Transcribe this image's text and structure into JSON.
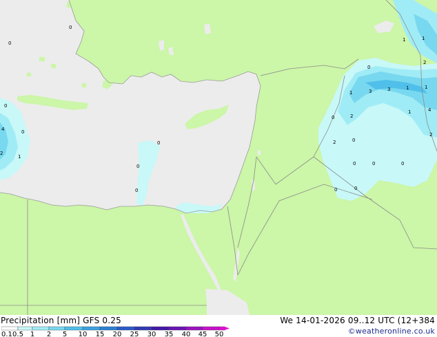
{
  "footer": {
    "title": "Precipitation [mm]  GFS 0.25",
    "datetime": "We 14-01-2026 09..12 UTC (12+384",
    "credit": "©weatheronline.co.uk"
  },
  "legend": {
    "ticks": [
      "0.1",
      "0.5",
      "1",
      "2",
      "5",
      "10",
      "15",
      "20",
      "25",
      "30",
      "35",
      "40",
      "45",
      "50"
    ],
    "colors": [
      "#ffffff",
      "#c8f8f8",
      "#a0ecf6",
      "#78d8ef",
      "#50c0ea",
      "#3aa2e0",
      "#2c80d4",
      "#2a5cc8",
      "#3038b4",
      "#4218a8",
      "#6a14b4",
      "#9a12c0",
      "#c810cc",
      "#e80cd8"
    ]
  },
  "colors": {
    "land": "#ccf6a8",
    "sea": "#ececec",
    "border": "#8a8a8a"
  },
  "map_values": [
    "1",
    "1",
    "0",
    "1",
    "2",
    "2",
    "0",
    "1",
    "3",
    "3",
    "1",
    "1",
    "4",
    "2",
    "0",
    "2",
    "0",
    "0",
    "0",
    "0",
    "0",
    "0",
    "0",
    "0",
    "0",
    "4",
    "1",
    "2",
    "0",
    "0",
    "0"
  ]
}
